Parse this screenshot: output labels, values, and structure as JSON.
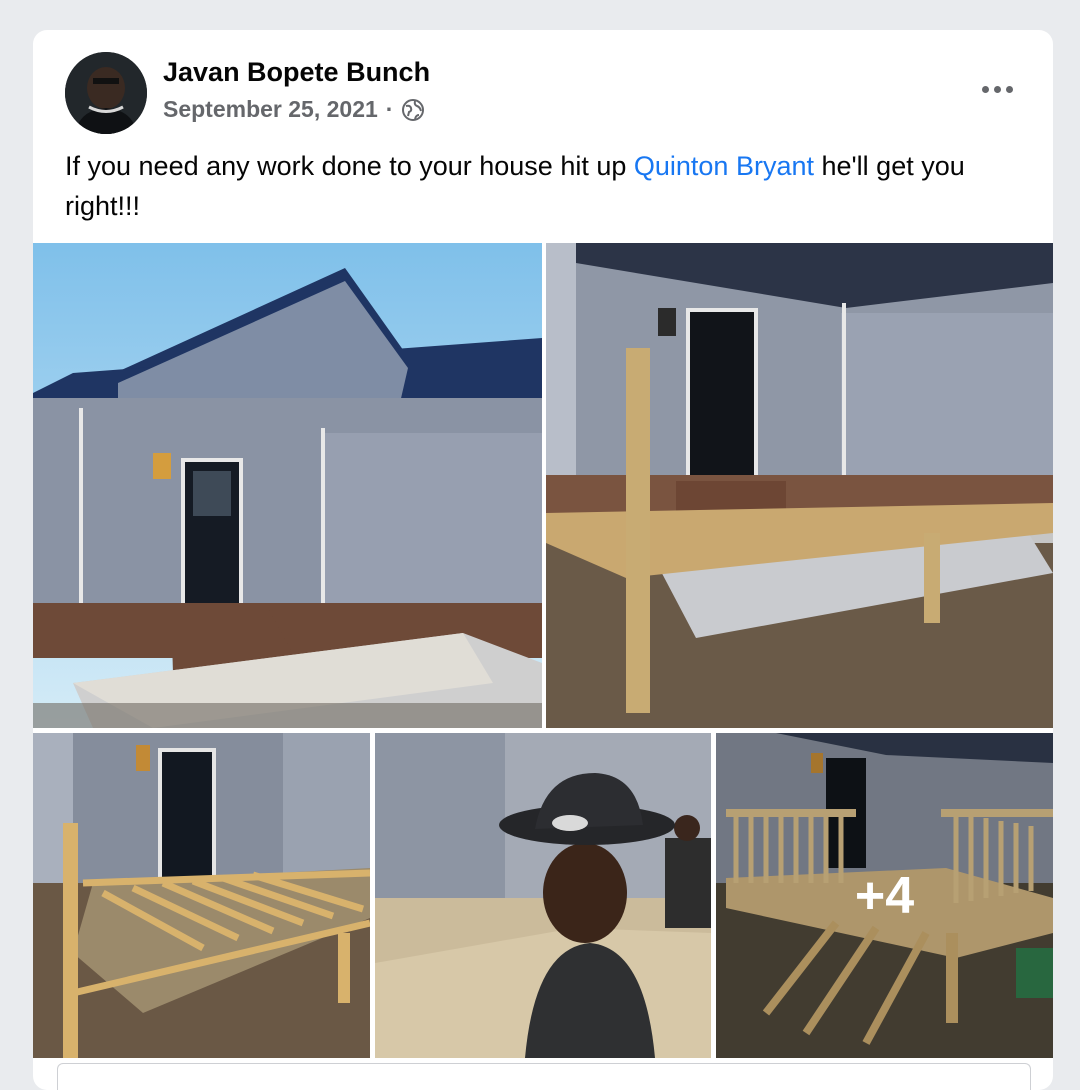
{
  "post": {
    "author": "Javan Bopete Bunch",
    "date": "September 25, 2021",
    "separator": "·",
    "audience_icon": "globe-icon",
    "more_icon": "more-horizontal-icon",
    "text_before": "If you need any work done to your house hit up ",
    "mention": "Quinton Bryant",
    "text_after": " he'll get you right!!!",
    "more_photos": "+4"
  },
  "colors": {
    "link": "#1877f2",
    "secondary_text": "#65676b",
    "page_bg": "#e9ebee"
  }
}
